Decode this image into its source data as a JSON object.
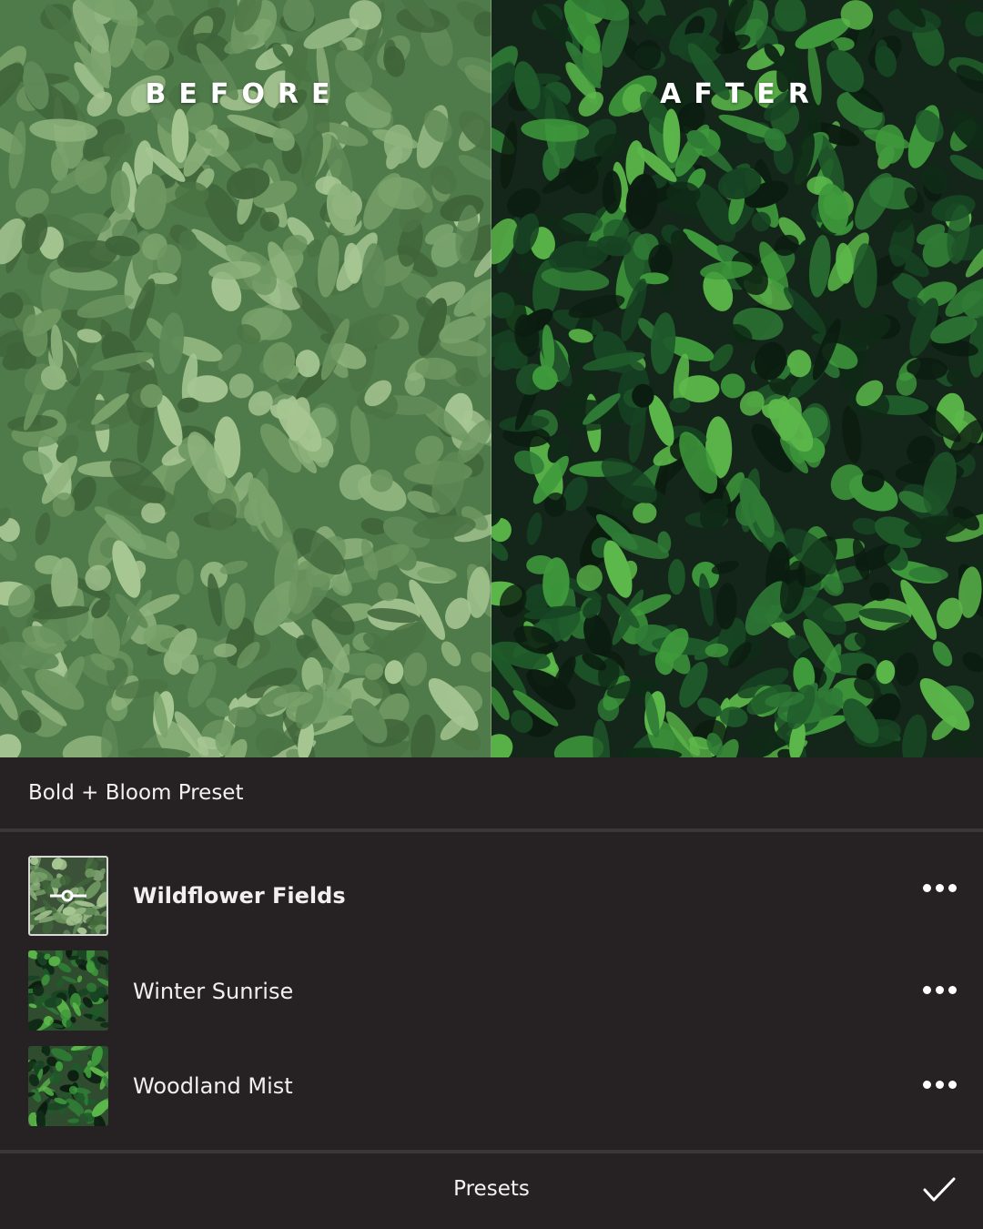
{
  "comparison": {
    "before_label": "BEFORE",
    "after_label": "AFTER"
  },
  "preset_group": {
    "title": "Bold + Bloom Preset"
  },
  "presets": [
    {
      "name": "Wildflower Fields",
      "selected": true,
      "icon": "adjust-sliders-icon",
      "more_icon": "more-horizontal-icon"
    },
    {
      "name": "Winter Sunrise",
      "selected": false,
      "more_icon": "more-horizontal-icon"
    },
    {
      "name": "Woodland Mist",
      "selected": false,
      "more_icon": "more-horizontal-icon"
    }
  ],
  "bottom_bar": {
    "label": "Presets",
    "confirm_icon": "checkmark-icon"
  },
  "colors": {
    "panel_background": "#262223",
    "separator": "#3b3738",
    "text": "#f3f1f1"
  }
}
